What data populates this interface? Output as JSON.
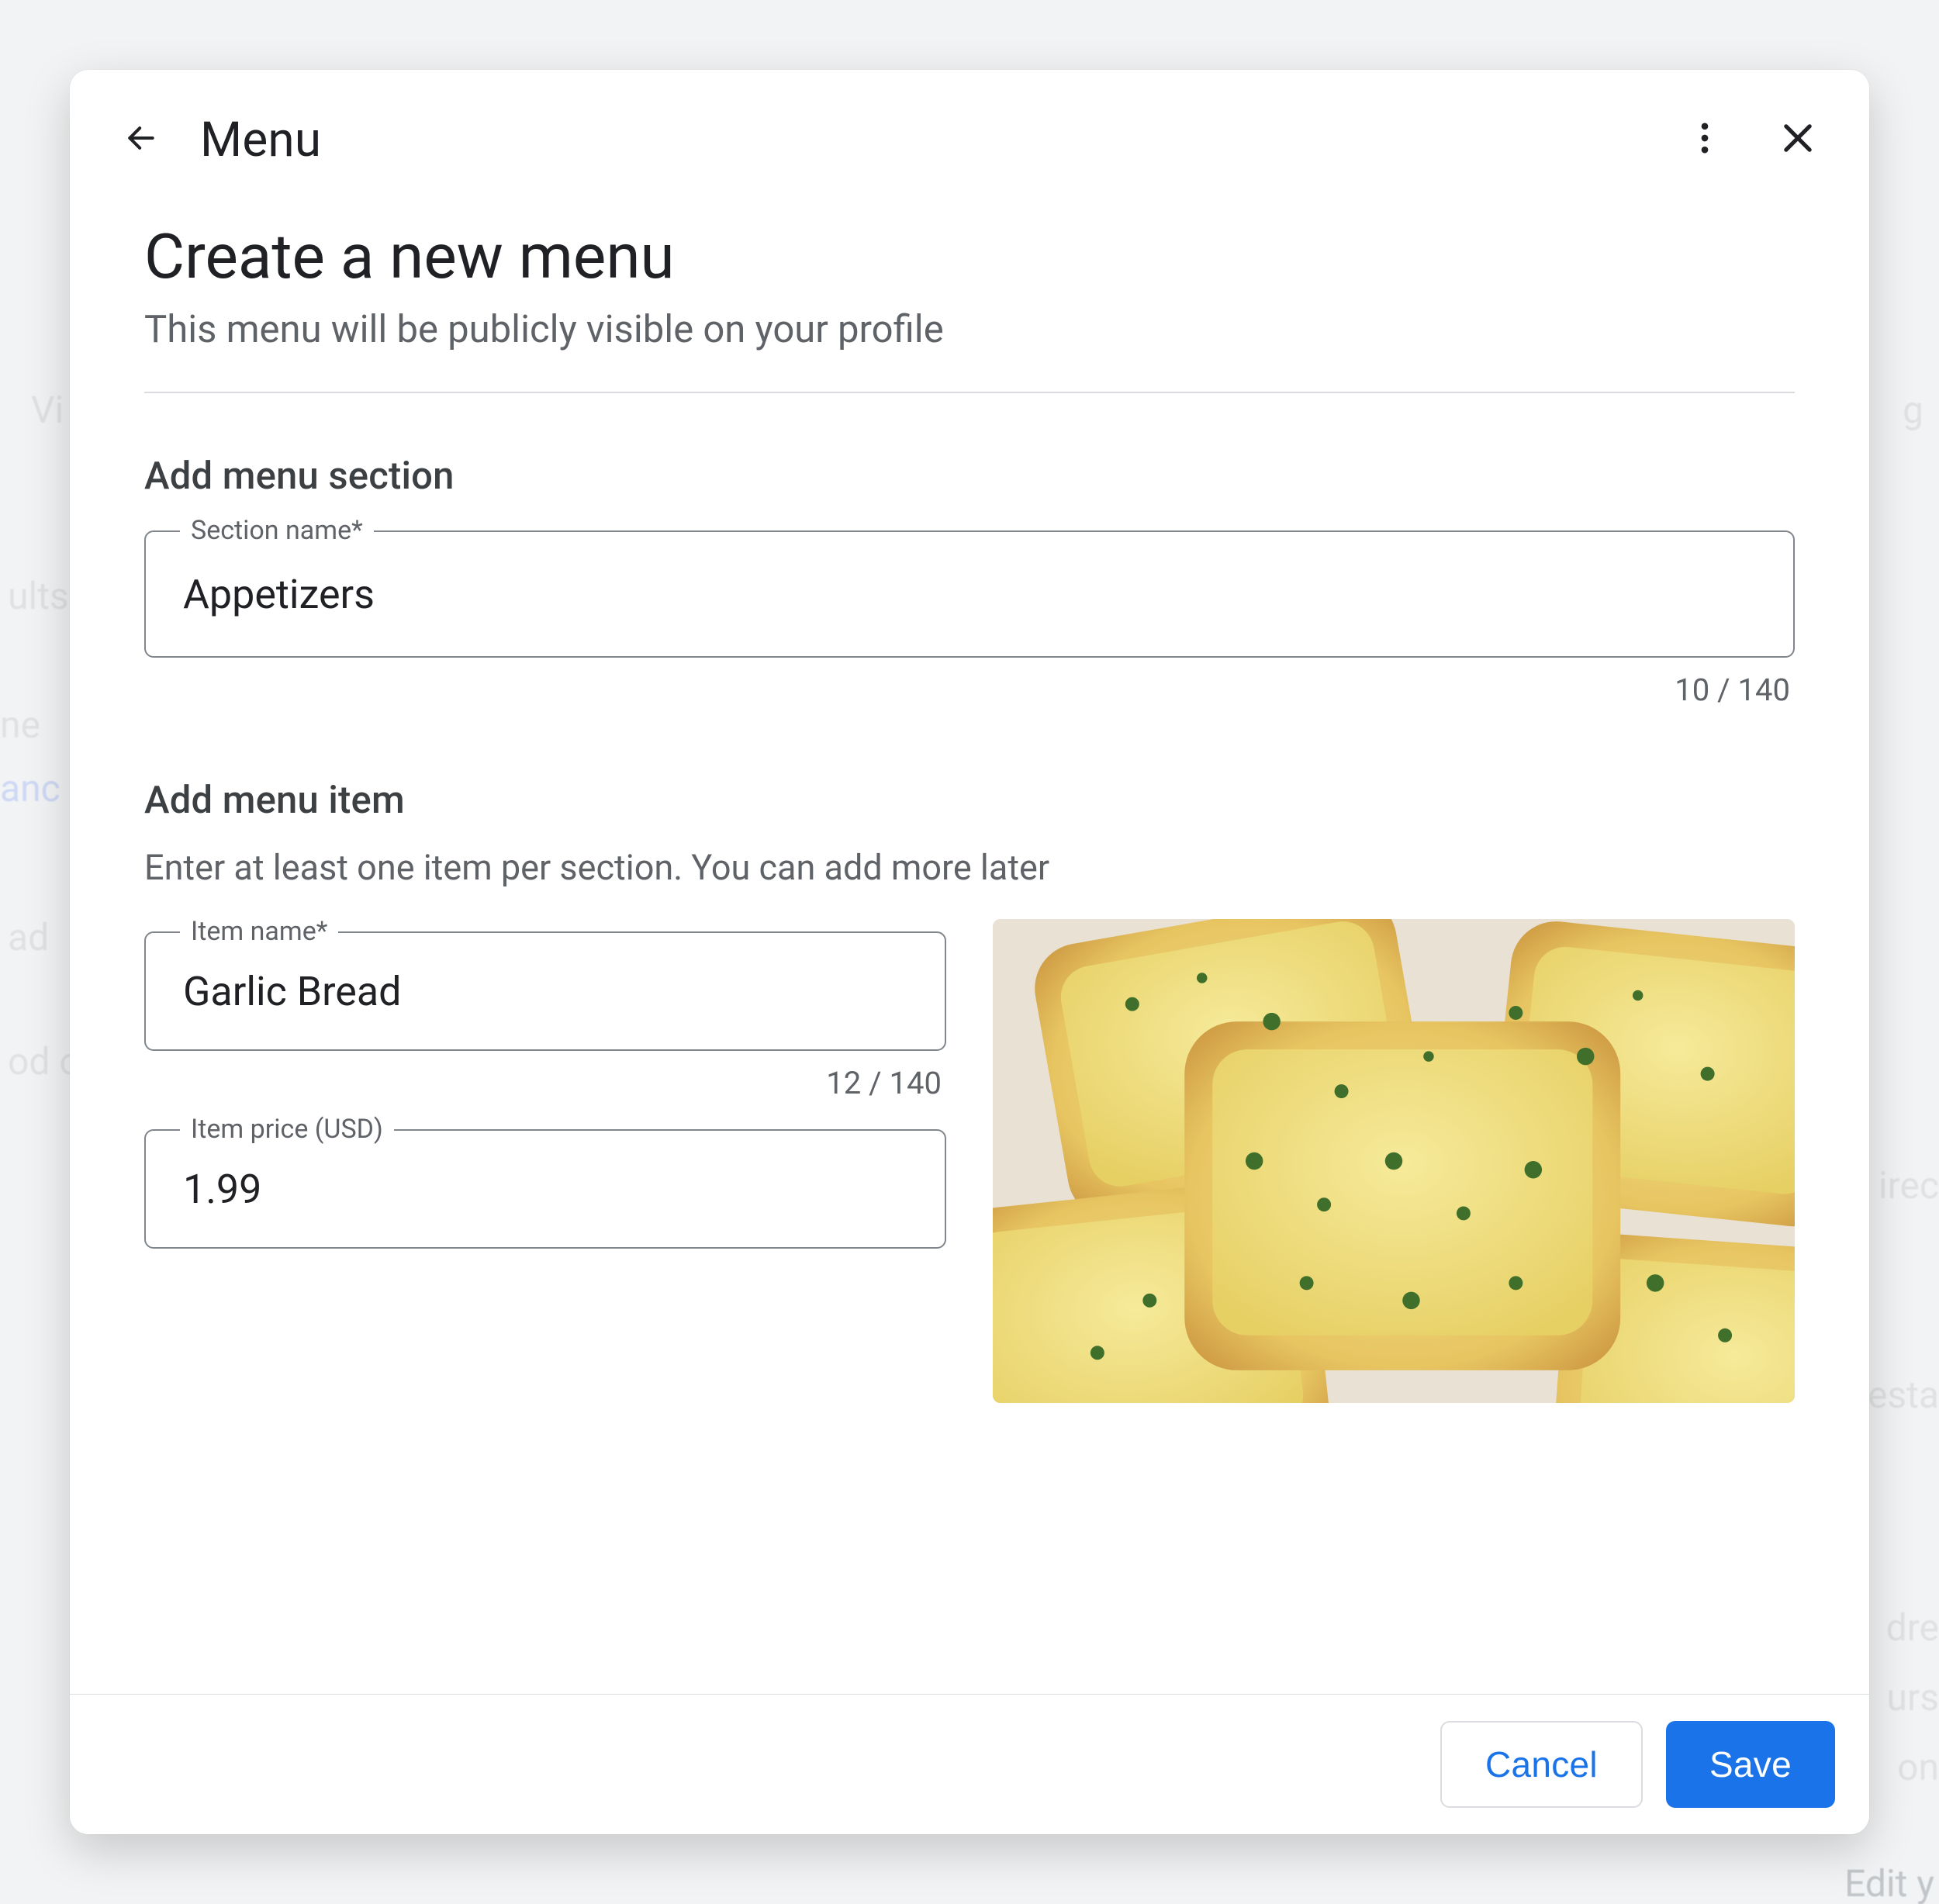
{
  "header": {
    "title": "Menu"
  },
  "main": {
    "heading": "Create a new menu",
    "subheading": "This menu will be publicly visible on your profile"
  },
  "section": {
    "title": "Add menu section",
    "name_label": "Section name*",
    "name_value": "Appetizers",
    "counter": "10 / 140"
  },
  "item": {
    "title": "Add menu item",
    "description": "Enter at least one item per section. You can add more later",
    "name_label": "Item name*",
    "name_value": "Garlic Bread",
    "name_counter": "12 / 140",
    "price_label": "Item price (USD)",
    "price_value": "1.99",
    "image_alt": "Garlic bread photo"
  },
  "footer": {
    "cancel": "Cancel",
    "save": "Save"
  },
  "colors": {
    "primary": "#1a73e8",
    "text": "#202124",
    "muted": "#5f6368"
  }
}
